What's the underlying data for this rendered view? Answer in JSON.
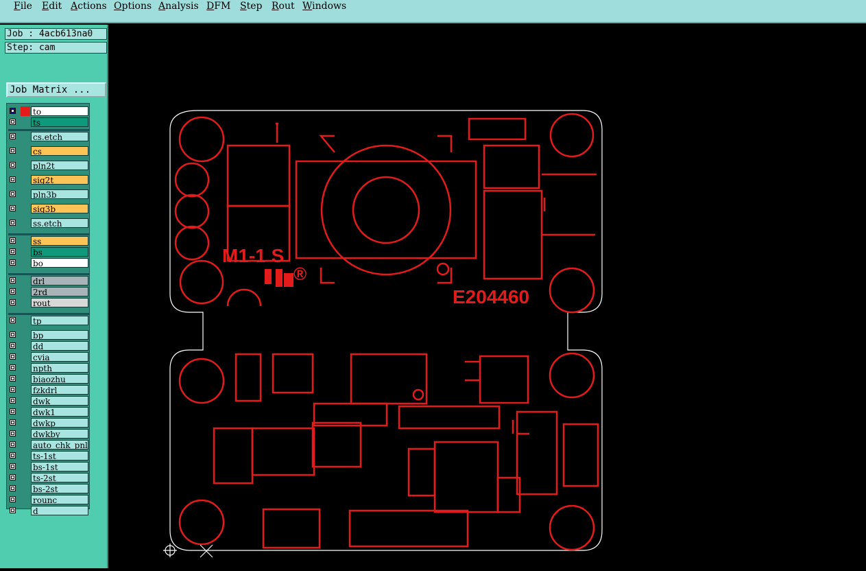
{
  "menu": [
    {
      "label": "File"
    },
    {
      "label": "Edit"
    },
    {
      "label": "Actions"
    },
    {
      "label": "Options"
    },
    {
      "label": "Analysis"
    },
    {
      "label": "DFM"
    },
    {
      "label": "Step"
    },
    {
      "label": "Rout"
    },
    {
      "label": "Windows"
    }
  ],
  "job": {
    "label": "Job : 4acb613na0",
    "step": "Step: cam"
  },
  "job_matrix_label": "Job Matrix ...",
  "layers": [
    {
      "name": "to",
      "color": "#ffffff"
    },
    {
      "name": "ts",
      "color": "#0e9a7a"
    },
    {
      "name": "cs.etch",
      "color": "#a8e4e0"
    },
    {
      "name": "cs",
      "color": "#ffc458"
    },
    {
      "name": "pln2t",
      "color": "#a8e4e0"
    },
    {
      "name": "sig2t",
      "color": "#ffc458"
    },
    {
      "name": "pln3b",
      "color": "#a8e4e0"
    },
    {
      "name": "sig3b",
      "color": "#ffc458"
    },
    {
      "name": "ss.etch",
      "color": "#a8e4e0"
    },
    {
      "name": "ss",
      "color": "#ffc458"
    },
    {
      "name": "bs",
      "color": "#0e9a7a"
    },
    {
      "name": "bo",
      "color": "#ffffff"
    },
    {
      "name": "drl",
      "color": "#a8b4b8"
    },
    {
      "name": "2rd",
      "color": "#a8b4b8"
    },
    {
      "name": "rout",
      "color": "#d8d8d8"
    },
    {
      "name": "tp",
      "color": "#a8e4e0"
    },
    {
      "name": "bp",
      "color": "#a8e4e0"
    },
    {
      "name": "dd",
      "color": "#a8e4e0"
    },
    {
      "name": "cvia",
      "color": "#a8e4e0"
    },
    {
      "name": "npth",
      "color": "#a8e4e0"
    },
    {
      "name": "biaozhu",
      "color": "#a8e4e0"
    },
    {
      "name": "fzkdrl",
      "color": "#a8e4e0"
    },
    {
      "name": "dwk",
      "color": "#a8e4e0"
    },
    {
      "name": "dwk1",
      "color": "#a8e4e0"
    },
    {
      "name": "dwkp",
      "color": "#a8e4e0"
    },
    {
      "name": "dwkby",
      "color": "#a8e4e0"
    },
    {
      "name": "auto_chk_pnl",
      "color": "#a8e4e0"
    },
    {
      "name": "ts-1st",
      "color": "#a8e4e0"
    },
    {
      "name": "bs-1st",
      "color": "#a8e4e0"
    },
    {
      "name": "ts-2st",
      "color": "#a8e4e0"
    },
    {
      "name": "bs-2st",
      "color": "#a8e4e0"
    },
    {
      "name": "rounc",
      "color": "#a8e4e0"
    },
    {
      "name": "d",
      "color": "#a8e4e0"
    }
  ],
  "board": {
    "silk_text_model": "M1-1 S",
    "silk_text_cert": "E204460",
    "ur_mark": "ᴿ𝐔",
    "registered": "®",
    "trace_color": "#e41b1b",
    "outline_color": "#ffffff"
  }
}
